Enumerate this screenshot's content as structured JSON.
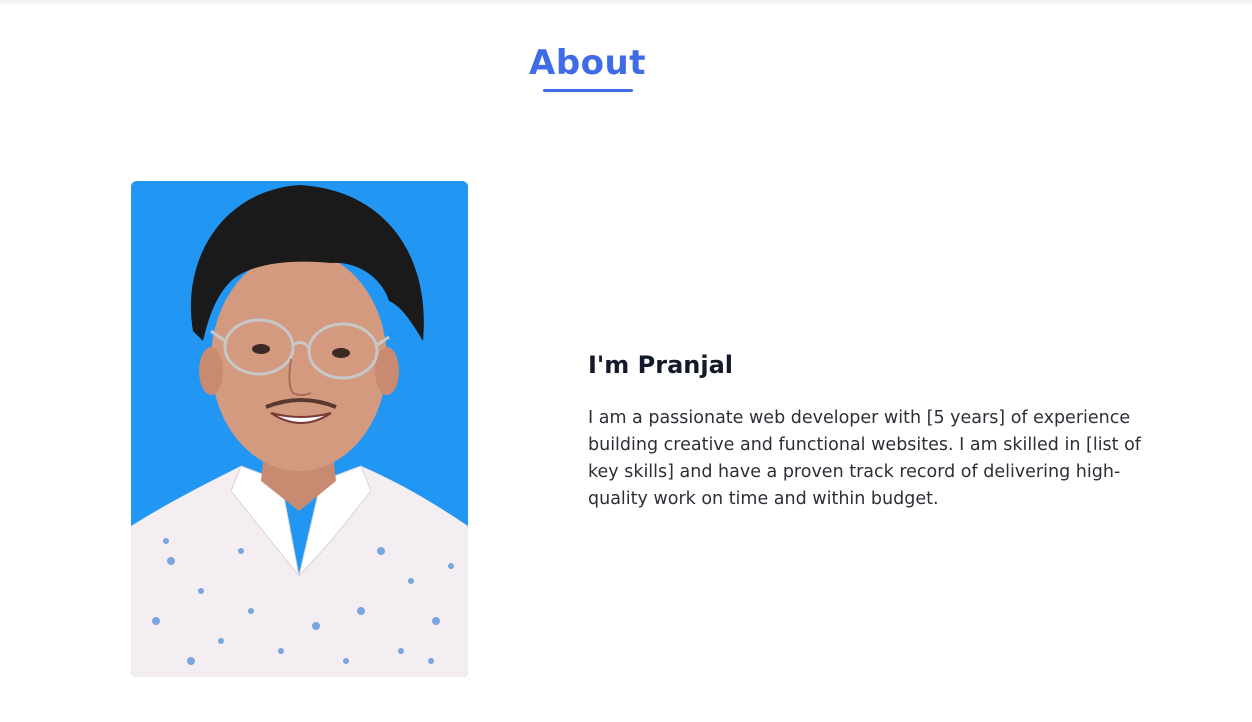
{
  "section": {
    "title": "About"
  },
  "profile": {
    "photo_icon": "portrait-photo",
    "photo_bg": "#2196f3",
    "heading": "I'm Pranjal",
    "description": "I am a passionate web developer with [5 years] of experience building creative and functional websites. I am skilled in [list of key skills] and have a proven track record of delivering high-quality work on time and within budget."
  },
  "colors": {
    "accent": "#3f6ce6",
    "heading": "#13182a",
    "body_text": "#2c2f38"
  }
}
